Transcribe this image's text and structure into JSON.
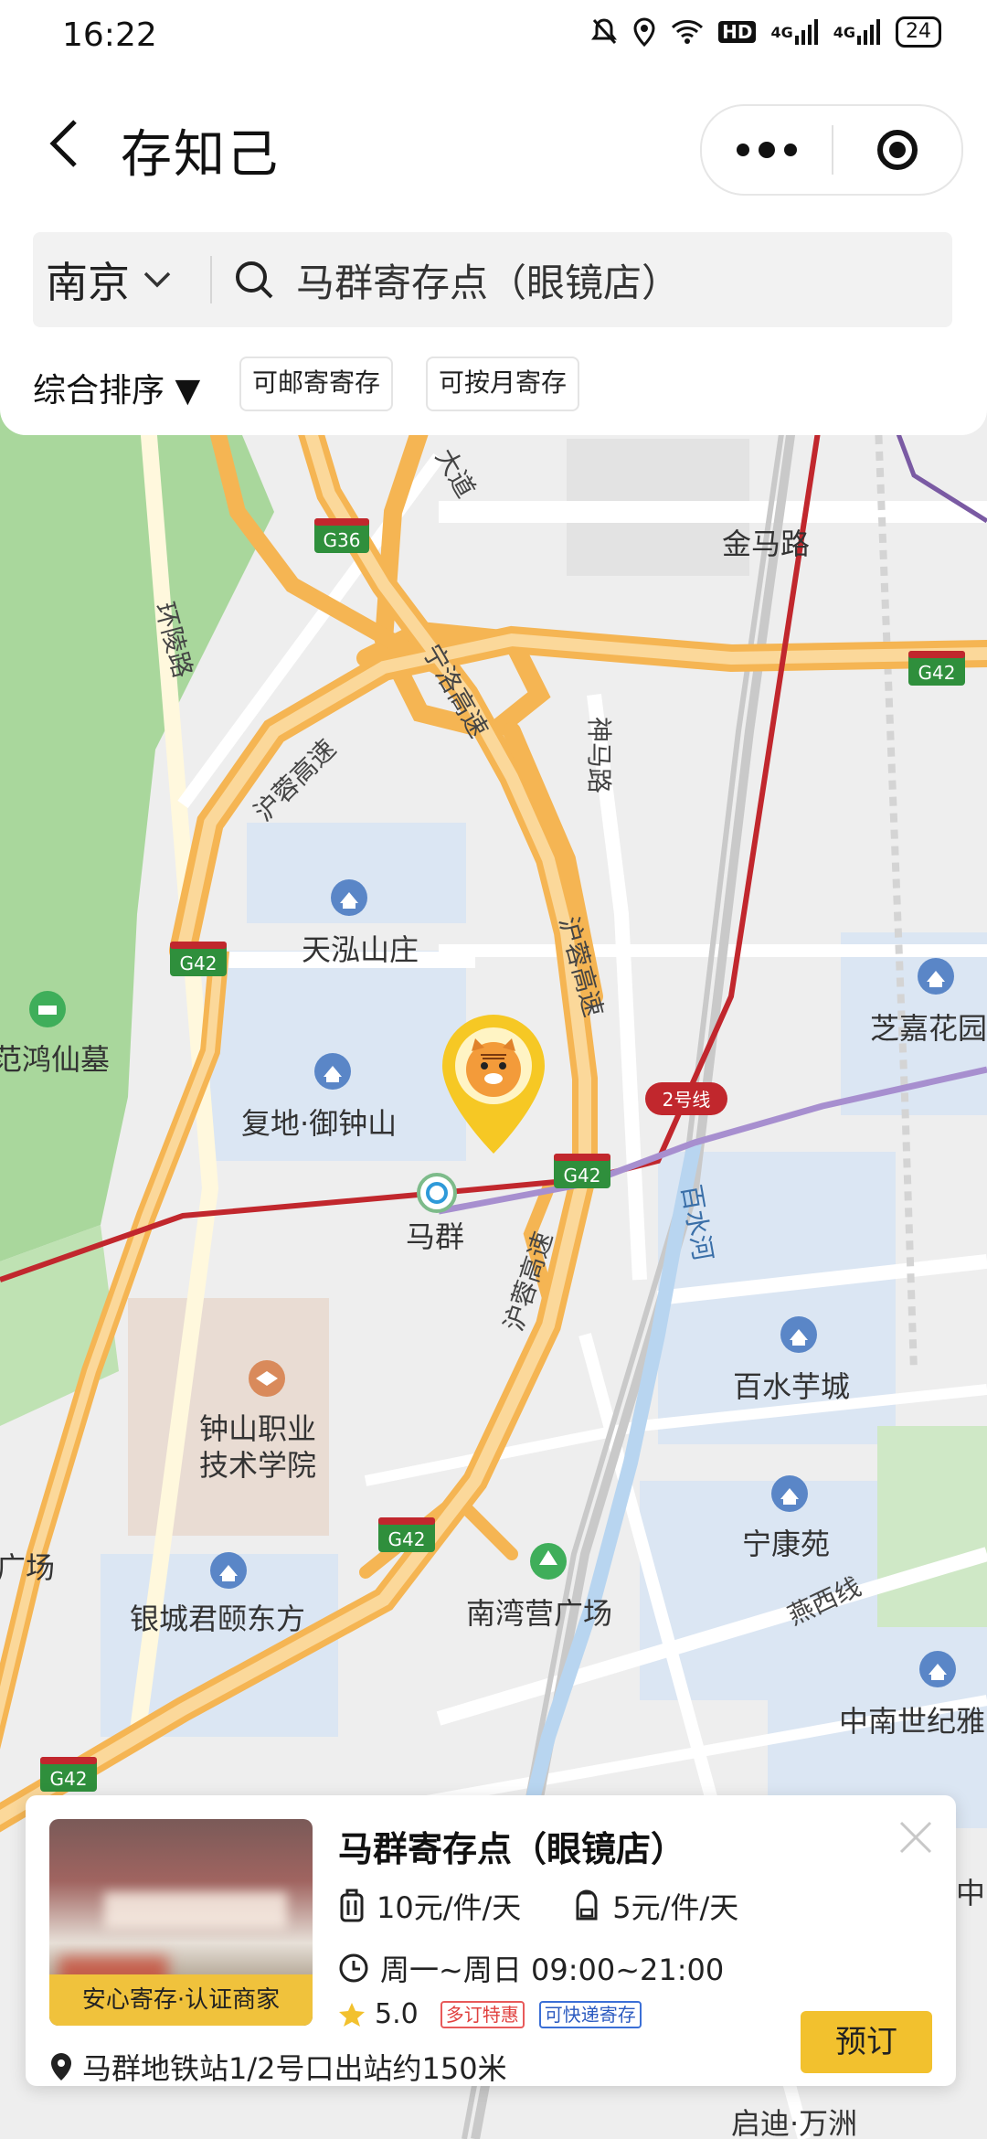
{
  "status_bar": {
    "time": "16:22",
    "hd_label": "HD",
    "signal1": "4G",
    "signal2": "4G",
    "battery": "24"
  },
  "header": {
    "title": "存知己"
  },
  "search": {
    "city": "南京",
    "query": "马群寄存点（眼镜店）"
  },
  "filters": {
    "sort_label": "综合排序 ▼",
    "chip_mail": "可邮寄寄存",
    "chip_monthly": "可按月寄存"
  },
  "map": {
    "labels": {
      "jinmalu": "金马路",
      "huanlinglu": "环陵路",
      "shenmalu": "神马路",
      "dadao": "大道",
      "hurong1": "沪蓉高速",
      "hurong2": "沪蓉高速",
      "hurong3": "沪蓉高速",
      "ningluo": "宁洛高速",
      "tianhong": "天泓山庄",
      "fudi": "复地·御钟山",
      "maqun": "马群",
      "zhijia": "芝嘉花园",
      "fanhong": "范鸿仙墓",
      "baishuihe": "百水河",
      "baishuiyu": "百水芋城",
      "zhongshan1": "钟山职业",
      "zhongshan2": "技术学院",
      "ningkang": "宁康苑",
      "nanwan": "南湾营广场",
      "yinchen": "银城君颐东方",
      "zhongnan": "中南世纪雅",
      "yanxi": "燕西线",
      "guangchang": "广场",
      "qidi": "启迪·万洲",
      "zhong": "中"
    },
    "shields": {
      "g36": "G36",
      "g42_a": "G42",
      "g42_b": "G42",
      "g42_c": "G42",
      "g42_d": "G42",
      "g42_e": "G42",
      "line2": "2号线"
    }
  },
  "store_card": {
    "name": "马群寄存点（眼镜店）",
    "image_tag": "安心寄存·认证商家",
    "price_luggage": "10元/件/天",
    "price_bag": "5元/件/天",
    "hours": "周一~周日 09:00~21:00",
    "rating": "5.0",
    "badge_discount": "多订特惠",
    "badge_delivery": "可快递寄存",
    "address": "马群地铁站1/2号口出站约150米",
    "book_label": "预订"
  },
  "colors": {
    "accent": "#f2c12e",
    "highway": "#f5b553",
    "metro_line2": "#c1272d",
    "park": "#a8d89a"
  }
}
